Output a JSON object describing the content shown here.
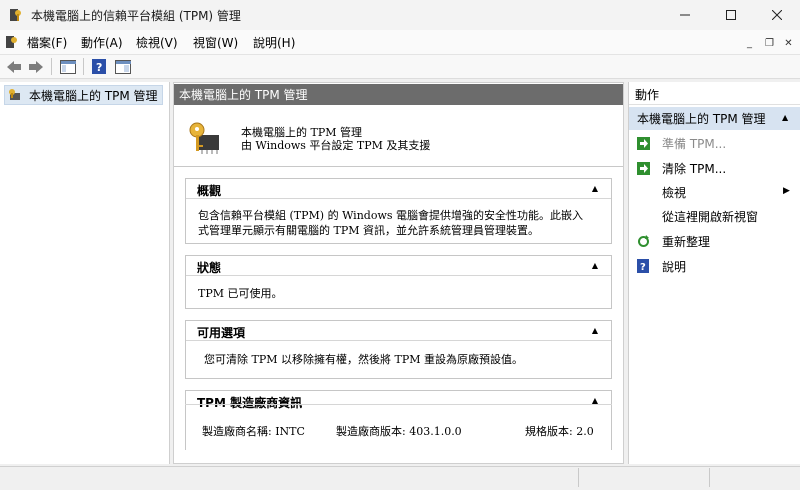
{
  "window": {
    "title": "本機電腦上的信賴平台模組 (TPM) 管理"
  },
  "menu": {
    "items": [
      "檔案(F)",
      "動作(A)",
      "檢視(V)",
      "視窗(W)",
      "說明(H)"
    ]
  },
  "tree": {
    "root_label": "本機電腦上的 TPM 管理"
  },
  "center": {
    "header": "本機電腦上的 TPM 管理",
    "intro_title": "本機電腦上的 TPM 管理",
    "intro_subtitle": "由 Windows 平台設定 TPM 及其支援",
    "sections": {
      "overview": {
        "title": "概觀",
        "body_line1": "包含信賴平台模組 (TPM) 的 Windows 電腦會提供增強的安全性功能。此嵌入",
        "body_line2": "式管理單元顯示有關電腦的 TPM 資訊，並允許系統管理員管理裝置。"
      },
      "status": {
        "title": "狀態",
        "body": "TPM 已可使用。"
      },
      "options": {
        "title": "可用選項",
        "body": "您可清除 TPM 以移除擁有權，然後將 TPM 重設為原廠預設值。"
      },
      "manufacturer": {
        "title": "TPM 製造廠商資訊",
        "name": "製造廠商名稱: INTC",
        "version": "製造廠商版本: 403.1.0.0",
        "spec": "規格版本: 2.0"
      }
    }
  },
  "actions": {
    "header": "動作",
    "group_label": "本機電腦上的 TPM 管理",
    "items": [
      {
        "label": "準備 TPM...",
        "icon": "green-arrow-icon",
        "enabled": false
      },
      {
        "label": "清除 TPM...",
        "icon": "green-arrow-icon",
        "enabled": true
      },
      {
        "label": "檢視",
        "icon": "",
        "enabled": true,
        "submenu": true
      },
      {
        "label": "從這裡開啟新視窗",
        "icon": "",
        "enabled": true
      },
      {
        "label": "重新整理",
        "icon": "refresh-icon",
        "enabled": true
      },
      {
        "label": "說明",
        "icon": "help-icon",
        "enabled": true
      }
    ]
  },
  "colors": {
    "pane_header_bg": "#6c6c6c",
    "selection_bg": "#d7e3f1",
    "action_icon_green": "#2f8f2f",
    "help_icon_blue": "#2b4fa8"
  }
}
